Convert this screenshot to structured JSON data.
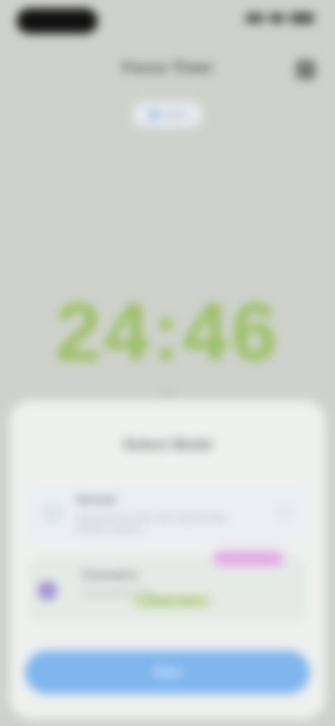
{
  "header": {
    "title": "Focus Timer"
  },
  "mode_chip": {
    "label": "Work"
  },
  "timer": {
    "display": "24:46",
    "caption": "••"
  },
  "sheet": {
    "title": "Select Mode",
    "options": [
      {
        "title": "Normal",
        "description": "Standard focus timer with regular breaks between sessions."
      },
      {
        "badge": "Recommended",
        "title": "Pomodoro",
        "description": "Focus session with",
        "highlight": "25 min + 5 min"
      }
    ],
    "cta_label": "Start"
  },
  "colors": {
    "background": "#cfd2cc",
    "timer_green": "#9bc063",
    "cta_blue": "#7fb6ee",
    "badge_pink": "#e9b8ee"
  }
}
